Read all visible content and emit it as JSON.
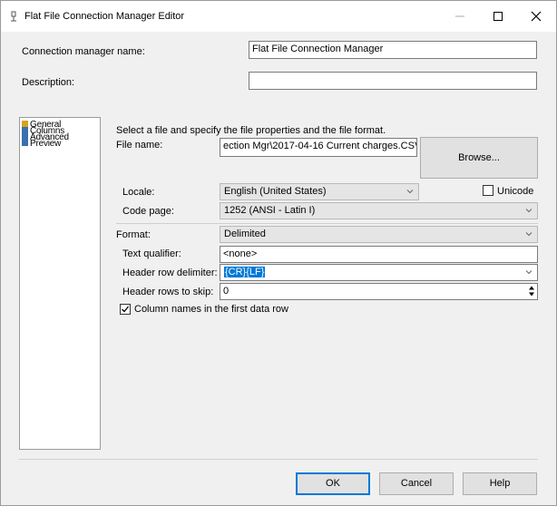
{
  "window": {
    "title": "Flat File Connection Manager Editor"
  },
  "fields": {
    "connection_name_label": "Connection manager name:",
    "connection_name_value": "Flat File Connection Manager",
    "description_label": "Description:",
    "description_value": ""
  },
  "nav": {
    "items": [
      {
        "label": "General"
      },
      {
        "label": "Columns"
      },
      {
        "label": "Advanced"
      },
      {
        "label": "Preview"
      }
    ]
  },
  "general": {
    "instruction": "Select a file and specify the file properties and the file format.",
    "file_name_label": "File name:",
    "file_name_value": "ection Mgr\\2017-04-16 Current charges.CSV",
    "browse_label": "Browse...",
    "locale_label": "Locale:",
    "locale_value": "English (United States)",
    "unicode_label": "Unicode",
    "unicode_checked": false,
    "code_page_label": "Code page:",
    "code_page_value": "1252  (ANSI - Latin I)",
    "format_label": "Format:",
    "format_value": "Delimited",
    "text_qualifier_label": "Text qualifier:",
    "text_qualifier_value": "<none>",
    "header_row_delimiter_label": "Header row delimiter:",
    "header_row_delimiter_value": "{CR}{LF}",
    "header_rows_skip_label": "Header rows to skip:",
    "header_rows_skip_value": "0",
    "column_names_label": "Column names in the first data row",
    "column_names_checked": true
  },
  "buttons": {
    "ok": "OK",
    "cancel": "Cancel",
    "help": "Help"
  },
  "colors": {
    "accent": "#0078d7",
    "panel": "#f0f0f0",
    "field_disabled": "#e5e5e5"
  }
}
